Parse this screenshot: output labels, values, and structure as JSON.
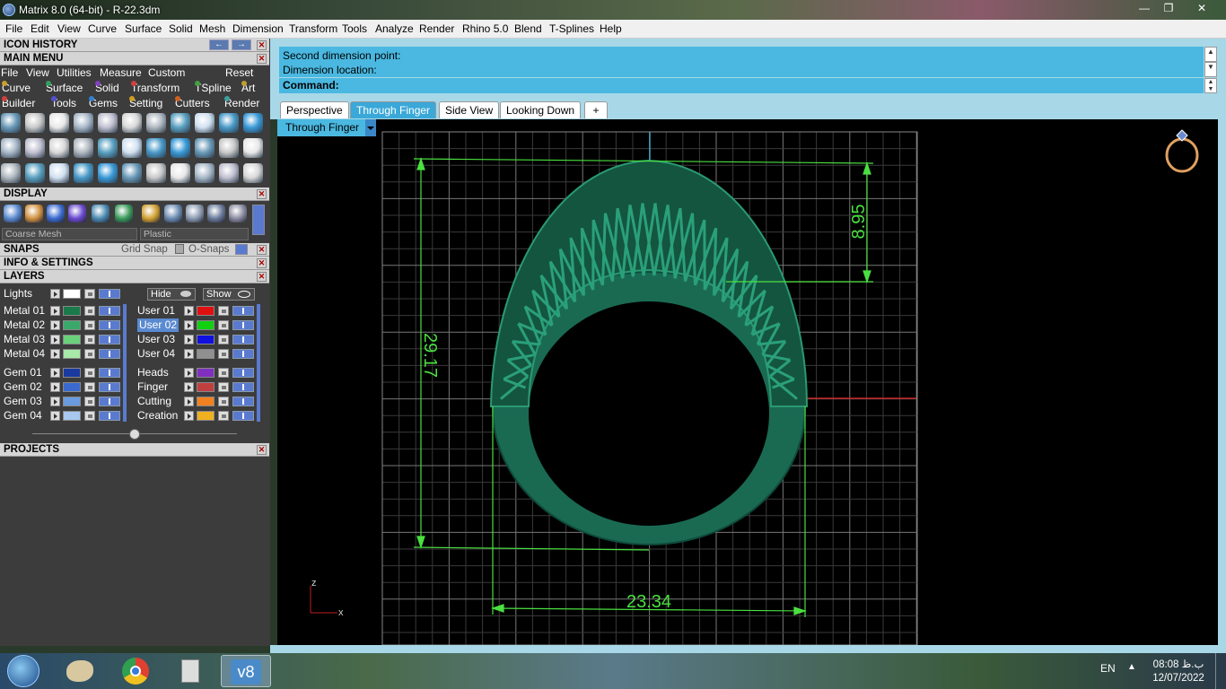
{
  "window": {
    "title": "Matrix 8.0 (64-bit) - R-22.3dm",
    "buttons": {
      "minimize": "—",
      "maximize": "❐",
      "close": "✕"
    }
  },
  "menubar": [
    "File",
    "Edit",
    "View",
    "Curve",
    "Surface",
    "Solid",
    "Mesh",
    "Dimension",
    "Transform",
    "Tools",
    "Analyze",
    "Render",
    "Rhino 5.0",
    "Blend",
    "T-Splines",
    "Help"
  ],
  "left": {
    "icon_history": "ICON HISTORY",
    "main_menu": "MAIN MENU",
    "main_menu_row1": [
      "File",
      "View",
      "Utilities",
      "Measure",
      "Custom"
    ],
    "reset": "Reset",
    "category_row1": [
      {
        "label": "Curve",
        "color": "#c8a030"
      },
      {
        "label": "Surface",
        "color": "#30a060"
      },
      {
        "label": "Solid",
        "color": "#8040c0"
      },
      {
        "label": "Transform",
        "color": "#d04040"
      },
      {
        "label": "TSpline",
        "color": "#40a040"
      },
      {
        "label": "Art",
        "color": "#c0a030"
      }
    ],
    "category_row2": [
      {
        "label": "Builder",
        "color": "#d04040"
      },
      {
        "label": "Tools",
        "color": "#5050d0"
      },
      {
        "label": "Gems",
        "color": "#3080d0"
      },
      {
        "label": "Setting",
        "color": "#d0a020"
      },
      {
        "label": "Cutters",
        "color": "#d06020"
      },
      {
        "label": "Render",
        "color": "#40a0a0"
      }
    ],
    "display": "DISPLAY",
    "mesh_dropdown": "Coarse Mesh",
    "material_dropdown": "Plastic",
    "snaps": "SNAPS",
    "grid_snap": "Grid Snap",
    "o_snaps": "O-Snaps",
    "info_settings": "INFO & SETTINGS",
    "layers": "LAYERS",
    "lights": "Lights",
    "hide": "Hide",
    "show": "Show",
    "projects": "PROJECTS",
    "layers_left": [
      {
        "name": "Metal 01",
        "color": "#1a7a4a"
      },
      {
        "name": "Metal 02",
        "color": "#3aa86a"
      },
      {
        "name": "Metal 03",
        "color": "#6ad07a"
      },
      {
        "name": "Metal 04",
        "color": "#a8e8a8"
      },
      {
        "name": "Gem 01",
        "color": "#1a3aa0"
      },
      {
        "name": "Gem 02",
        "color": "#3a6ad0"
      },
      {
        "name": "Gem 03",
        "color": "#6a9ae0"
      },
      {
        "name": "Gem 04",
        "color": "#a8c8f0"
      }
    ],
    "layers_right": [
      {
        "name": "User 01",
        "color": "#e01010"
      },
      {
        "name": "User 02",
        "color": "#10d010"
      },
      {
        "name": "User 03",
        "color": "#1010e0"
      },
      {
        "name": "User 04",
        "color": "#909090"
      },
      {
        "name": "Heads",
        "color": "#8030c0"
      },
      {
        "name": "Finger",
        "color": "#c04040"
      },
      {
        "name": "Cutting",
        "color": "#f08020"
      },
      {
        "name": "Creation",
        "color": "#f0b020"
      }
    ]
  },
  "command": {
    "history": [
      "Second dimension point:",
      "Dimension location:"
    ],
    "prompt": "Command:"
  },
  "tabs": [
    {
      "label": "Perspective",
      "active": false
    },
    {
      "label": "Through Finger",
      "active": true
    },
    {
      "label": "Side View",
      "active": false
    },
    {
      "label": "Looking Down",
      "active": false
    }
  ],
  "add_tab": "+",
  "viewport": {
    "label": "Through Finger",
    "dimensions": {
      "width": "23.34",
      "height": "29.17",
      "top": "8.95"
    },
    "axis_z": "z",
    "axis_x": "x",
    "colors": {
      "ring": "#1a7a5a",
      "dimension": "#4ae040",
      "grid": "#555555"
    }
  },
  "taskbar": {
    "lang": "EN",
    "time": "08:08 ب.ظ",
    "date": "12/07/2022"
  }
}
